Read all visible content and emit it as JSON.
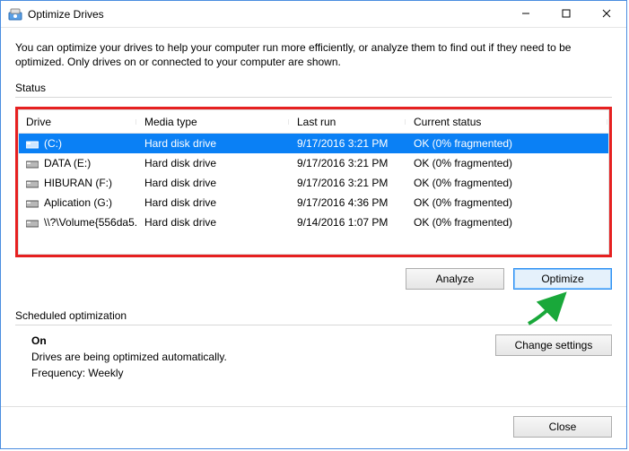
{
  "window": {
    "title": "Optimize Drives",
    "minimize": "—",
    "maximize": "☐",
    "close": "✕"
  },
  "description": "You can optimize your drives to help your computer run more efficiently, or analyze them to find out if they need to be optimized. Only drives on or connected to your computer are shown.",
  "status_label": "Status",
  "columns": {
    "drive": "Drive",
    "media": "Media type",
    "last": "Last run",
    "status": "Current status"
  },
  "drives": [
    {
      "name": "(C:)",
      "media": "Hard disk drive",
      "last": "9/17/2016 3:21 PM",
      "status": "OK (0% fragmented)",
      "selected": true
    },
    {
      "name": "DATA (E:)",
      "media": "Hard disk drive",
      "last": "9/17/2016 3:21 PM",
      "status": "OK (0% fragmented)",
      "selected": false
    },
    {
      "name": "HIBURAN (F:)",
      "media": "Hard disk drive",
      "last": "9/17/2016 3:21 PM",
      "status": "OK (0% fragmented)",
      "selected": false
    },
    {
      "name": "Aplication (G:)",
      "media": "Hard disk drive",
      "last": "9/17/2016 4:36 PM",
      "status": "OK (0% fragmented)",
      "selected": false
    },
    {
      "name": "\\\\?\\Volume{556da5...",
      "media": "Hard disk drive",
      "last": "9/14/2016 1:07 PM",
      "status": "OK (0% fragmented)",
      "selected": false
    }
  ],
  "buttons": {
    "analyze": "Analyze",
    "optimize": "Optimize",
    "change": "Change settings",
    "close": "Close"
  },
  "scheduled": {
    "label": "Scheduled optimization",
    "state": "On",
    "desc": "Drives are being optimized automatically.",
    "freq": "Frequency: Weekly"
  }
}
